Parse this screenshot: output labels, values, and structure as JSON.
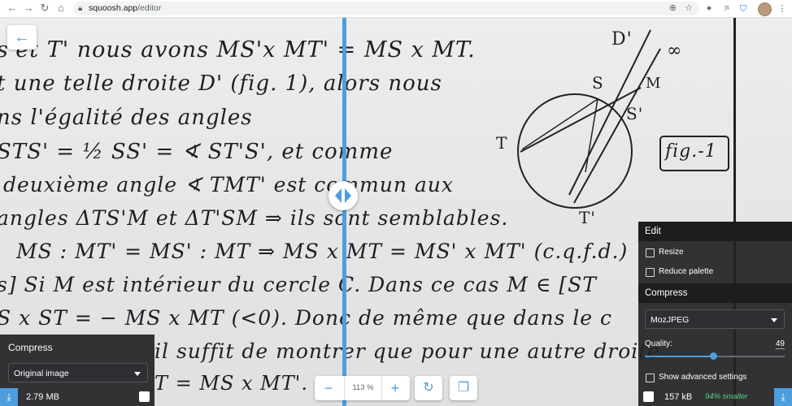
{
  "browser": {
    "url_host": "squoosh.app",
    "url_path": "/editor",
    "icons": [
      "back-icon",
      "forward-icon",
      "reload-icon",
      "home-icon",
      "lock-icon",
      "zoom-icon",
      "star-icon",
      "extension-pin-icon",
      "extension-js-icon",
      "extension-shield-icon",
      "puzzle-icon",
      "avatar"
    ]
  },
  "document_text": {
    "line1": "s'et T' nous avons  MS'x MT' = MS x MT.",
    "line2": "t une telle droite D' (fig. 1), alors nous",
    "line3": "ns l'égalité des angles",
    "line4": "STS' = ½ SS' = ∢ ST'S',  et comme",
    "line5": "deuxième angle ∢ TMT' est commun aux",
    "line6": "angles ΔTS'M et ΔT'SM ⇒ ils sont semblables.",
    "line7": "MS : MT' = MS' : MT ⇒ MS x MT = MS' x MT'  (c.q.f.d.)",
    "line8": "s]  Si M est intérieur du cercle C. Dans ce cas M ∈ [ST",
    "line9": "S x ST = − MS x MT (<0). Donc de même que dans le c",
    "line10": "il suffit de montrer que pour une autre droite",
    "line11": "T = MS x MT'.",
    "fig_label": "fig.-1",
    "fig_points": {
      "S": "S",
      "M": "M",
      "S2": "S'",
      "T": "T",
      "T2": "T'",
      "D": "∞",
      "D2": "D'"
    }
  },
  "divider": {
    "accent": "#4e9dde"
  },
  "left_panel": {
    "title": "Compress",
    "select_value": "Original image",
    "size": "2.79 MB"
  },
  "right_panel": {
    "edit_title": "Edit",
    "resize_label": "Resize",
    "reduce_palette_label": "Reduce palette",
    "compress_title": "Compress",
    "codec_value": "MozJPEG",
    "quality_label": "Quality:",
    "quality_value": "49",
    "quality_fraction": 0.49,
    "advanced_label": "Show advanced settings",
    "size": "157 kB",
    "savings": "94% smaller",
    "savings_color": "#5ad38a"
  },
  "zoom": {
    "minus": "−",
    "value": "113 %",
    "plus": "+"
  },
  "accent_color": "#4e9dde"
}
